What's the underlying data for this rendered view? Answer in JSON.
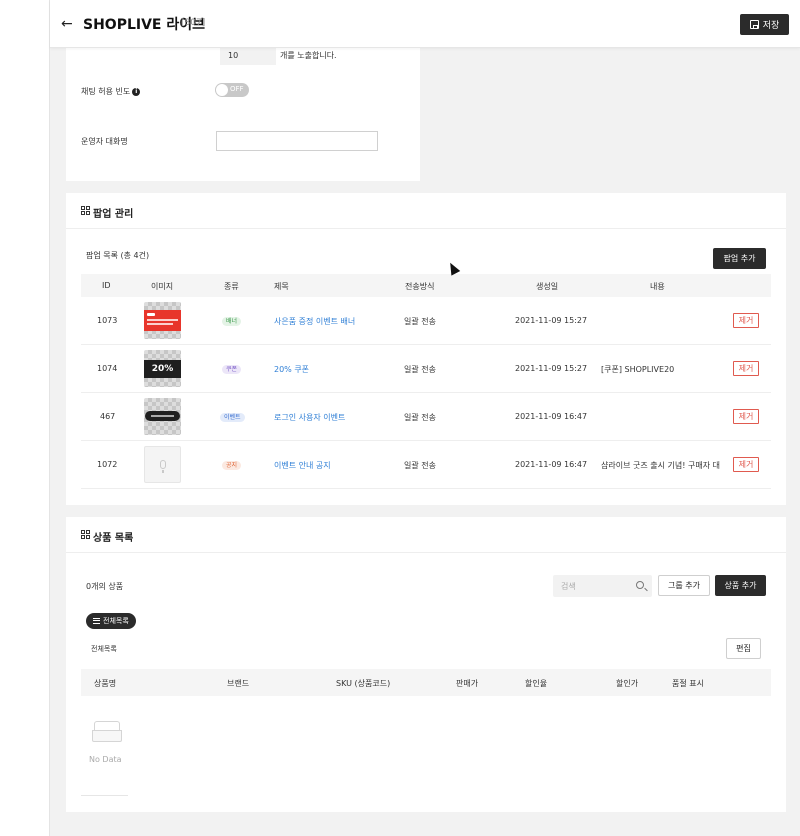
{
  "header": {
    "title": "SHOPLIVE 라이브",
    "id_label": "[807]",
    "save_label": "저장"
  },
  "settings": {
    "count_value": "10",
    "count_suffix": "개를 노출합니다.",
    "chat_freq_label": "채팅 허용 빈도",
    "toggle_state": "OFF",
    "operator_label": "운영자 대화명",
    "operator_value": ""
  },
  "popup_section": {
    "title": "팝업 관리",
    "list_title": "팝업 목록 (총 4건)",
    "add_button": "팝업 추가",
    "columns": [
      "ID",
      "이미지",
      "종류",
      "제목",
      "전송방식",
      "생성일",
      "내용"
    ],
    "remove_label": "제거",
    "rows": [
      {
        "id": "1073",
        "type": "배너",
        "type_color": "#3a9a4a",
        "type_bg": "#e4f3e6",
        "title": "사은품 증정 이벤트 배너",
        "send": "일괄 전송",
        "created": "2021-11-09 15:27",
        "content": ""
      },
      {
        "id": "1074",
        "type": "쿠폰",
        "type_color": "#7b5cc8",
        "type_bg": "#ece6f8",
        "title": "20% 쿠폰",
        "send": "일괄 전송",
        "created": "2021-11-09 15:27",
        "content": "[쿠폰] SHOPLIVE20"
      },
      {
        "id": "467",
        "type": "이벤트",
        "type_color": "#3a6fd0",
        "type_bg": "#e3ebfa",
        "title": "로그인 사용자 이벤트",
        "send": "일괄 전송",
        "created": "2021-11-09 16:47",
        "content": ""
      },
      {
        "id": "1072",
        "type": "공지",
        "type_color": "#e0683a",
        "type_bg": "#fbe9e1",
        "title": "이벤트 안내 공지",
        "send": "일괄 전송",
        "created": "2021-11-09 16:47",
        "content": "샵라이브 굿즈 출시 기념! 구매자 대"
      }
    ],
    "thumb_coupon_text": "20%"
  },
  "product_section": {
    "title": "상품 목록",
    "count_label": "0개의 상품",
    "search_placeholder": "검색",
    "group_add": "그룹 추가",
    "product_add": "상품 추가",
    "chip_label": "전체목록",
    "list_label": "전체목록",
    "edit_button": "편집",
    "columns": [
      "상품명",
      "브랜드",
      "SKU (상품코드)",
      "판매가",
      "할인율",
      "할인가",
      "품절 표시"
    ],
    "empty_text": "No Data"
  }
}
